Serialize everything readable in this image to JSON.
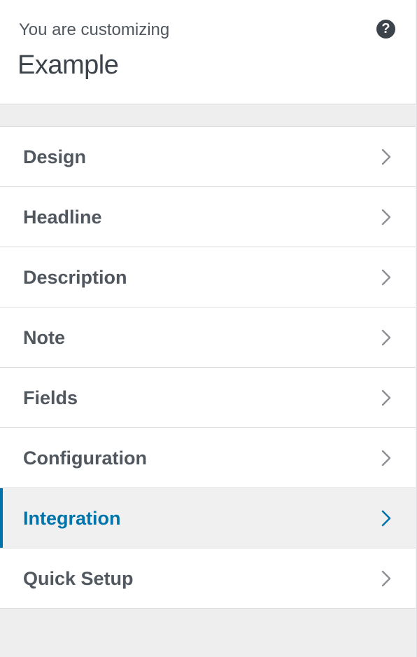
{
  "header": {
    "subtitle": "You are customizing",
    "title": "Example",
    "help_icon": "question-circle-icon"
  },
  "menu": {
    "items": [
      {
        "label": "Design",
        "active": false
      },
      {
        "label": "Headline",
        "active": false
      },
      {
        "label": "Description",
        "active": false
      },
      {
        "label": "Note",
        "active": false
      },
      {
        "label": "Fields",
        "active": false
      },
      {
        "label": "Configuration",
        "active": false
      },
      {
        "label": "Integration",
        "active": true
      },
      {
        "label": "Quick Setup",
        "active": false
      }
    ],
    "chevron_icon": "chevron-right-icon"
  },
  "colors": {
    "accent": "#0073aa",
    "text": "#50575e",
    "chevron": "#8c8f94",
    "background": "#eeeeee",
    "active_row_bg": "#f0f0f1"
  }
}
